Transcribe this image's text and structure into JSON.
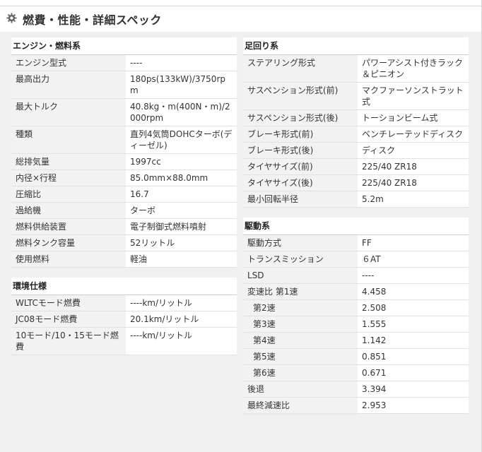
{
  "header": {
    "title": "燃費・性能・詳細スペック",
    "icon": "gear-icon"
  },
  "engine": {
    "title": "エンジン・燃料系",
    "rows": [
      {
        "k": "エンジン型式",
        "v": "----"
      },
      {
        "k": "最高出力",
        "v": "180ps(133kW)/3750rpm"
      },
      {
        "k": "最大トルク",
        "v": "40.8kg・m(400N・m)/2000rpm"
      },
      {
        "k": "種類",
        "v": "直列4気筒DOHCターボ(ディーゼル)"
      },
      {
        "k": "総排気量",
        "v": "1997cc"
      },
      {
        "k": "内径×行程",
        "v": "85.0mm×88.0mm"
      },
      {
        "k": "圧縮比",
        "v": "16.7"
      },
      {
        "k": "過給機",
        "v": "ターボ"
      },
      {
        "k": "燃料供給装置",
        "v": "電子制御式燃料噴射"
      },
      {
        "k": "燃料タンク容量",
        "v": "52リットル"
      },
      {
        "k": "使用燃料",
        "v": "軽油"
      }
    ]
  },
  "env": {
    "title": "環境仕様",
    "rows": [
      {
        "k": "WLTCモード燃費",
        "v": "----km/リットル"
      },
      {
        "k": "JC08モード燃費",
        "v": "20.1km/リットル"
      },
      {
        "k": "10モード/10・15モード燃費",
        "v": "----km/リットル"
      }
    ]
  },
  "chassis": {
    "title": "足回り系",
    "rows": [
      {
        "k": "ステアリング形式",
        "v": "パワーアシスト付きラック＆ピニオン"
      },
      {
        "k": "サスペンション形式(前)",
        "v": "マクファーソンストラット式"
      },
      {
        "k": "サスペンション形式(後)",
        "v": "トーションビーム式"
      },
      {
        "k": "ブレーキ形式(前)",
        "v": "ベンチレーテッドディスク"
      },
      {
        "k": "ブレーキ形式(後)",
        "v": "ディスク"
      },
      {
        "k": "タイヤサイズ(前)",
        "v": "225/40 ZR18"
      },
      {
        "k": "タイヤサイズ(後)",
        "v": "225/40 ZR18"
      },
      {
        "k": "最小回転半径",
        "v": "5.2m"
      }
    ]
  },
  "drive": {
    "title": "駆動系",
    "rows": [
      {
        "k": "駆動方式",
        "v": "FF"
      },
      {
        "k": "トランスミッション",
        "v": "６AT"
      },
      {
        "k": "LSD",
        "v": "----"
      },
      {
        "k": "変速比 第1速",
        "v": "4.458"
      },
      {
        "k": "第2速",
        "v": "2.508"
      },
      {
        "k": "第3速",
        "v": "1.555"
      },
      {
        "k": "第4速",
        "v": "1.142"
      },
      {
        "k": "第5速",
        "v": "0.851"
      },
      {
        "k": "第6速",
        "v": "0.671"
      },
      {
        "k": "後退",
        "v": "3.394"
      },
      {
        "k": "最終減速比",
        "v": "2.953"
      }
    ]
  }
}
